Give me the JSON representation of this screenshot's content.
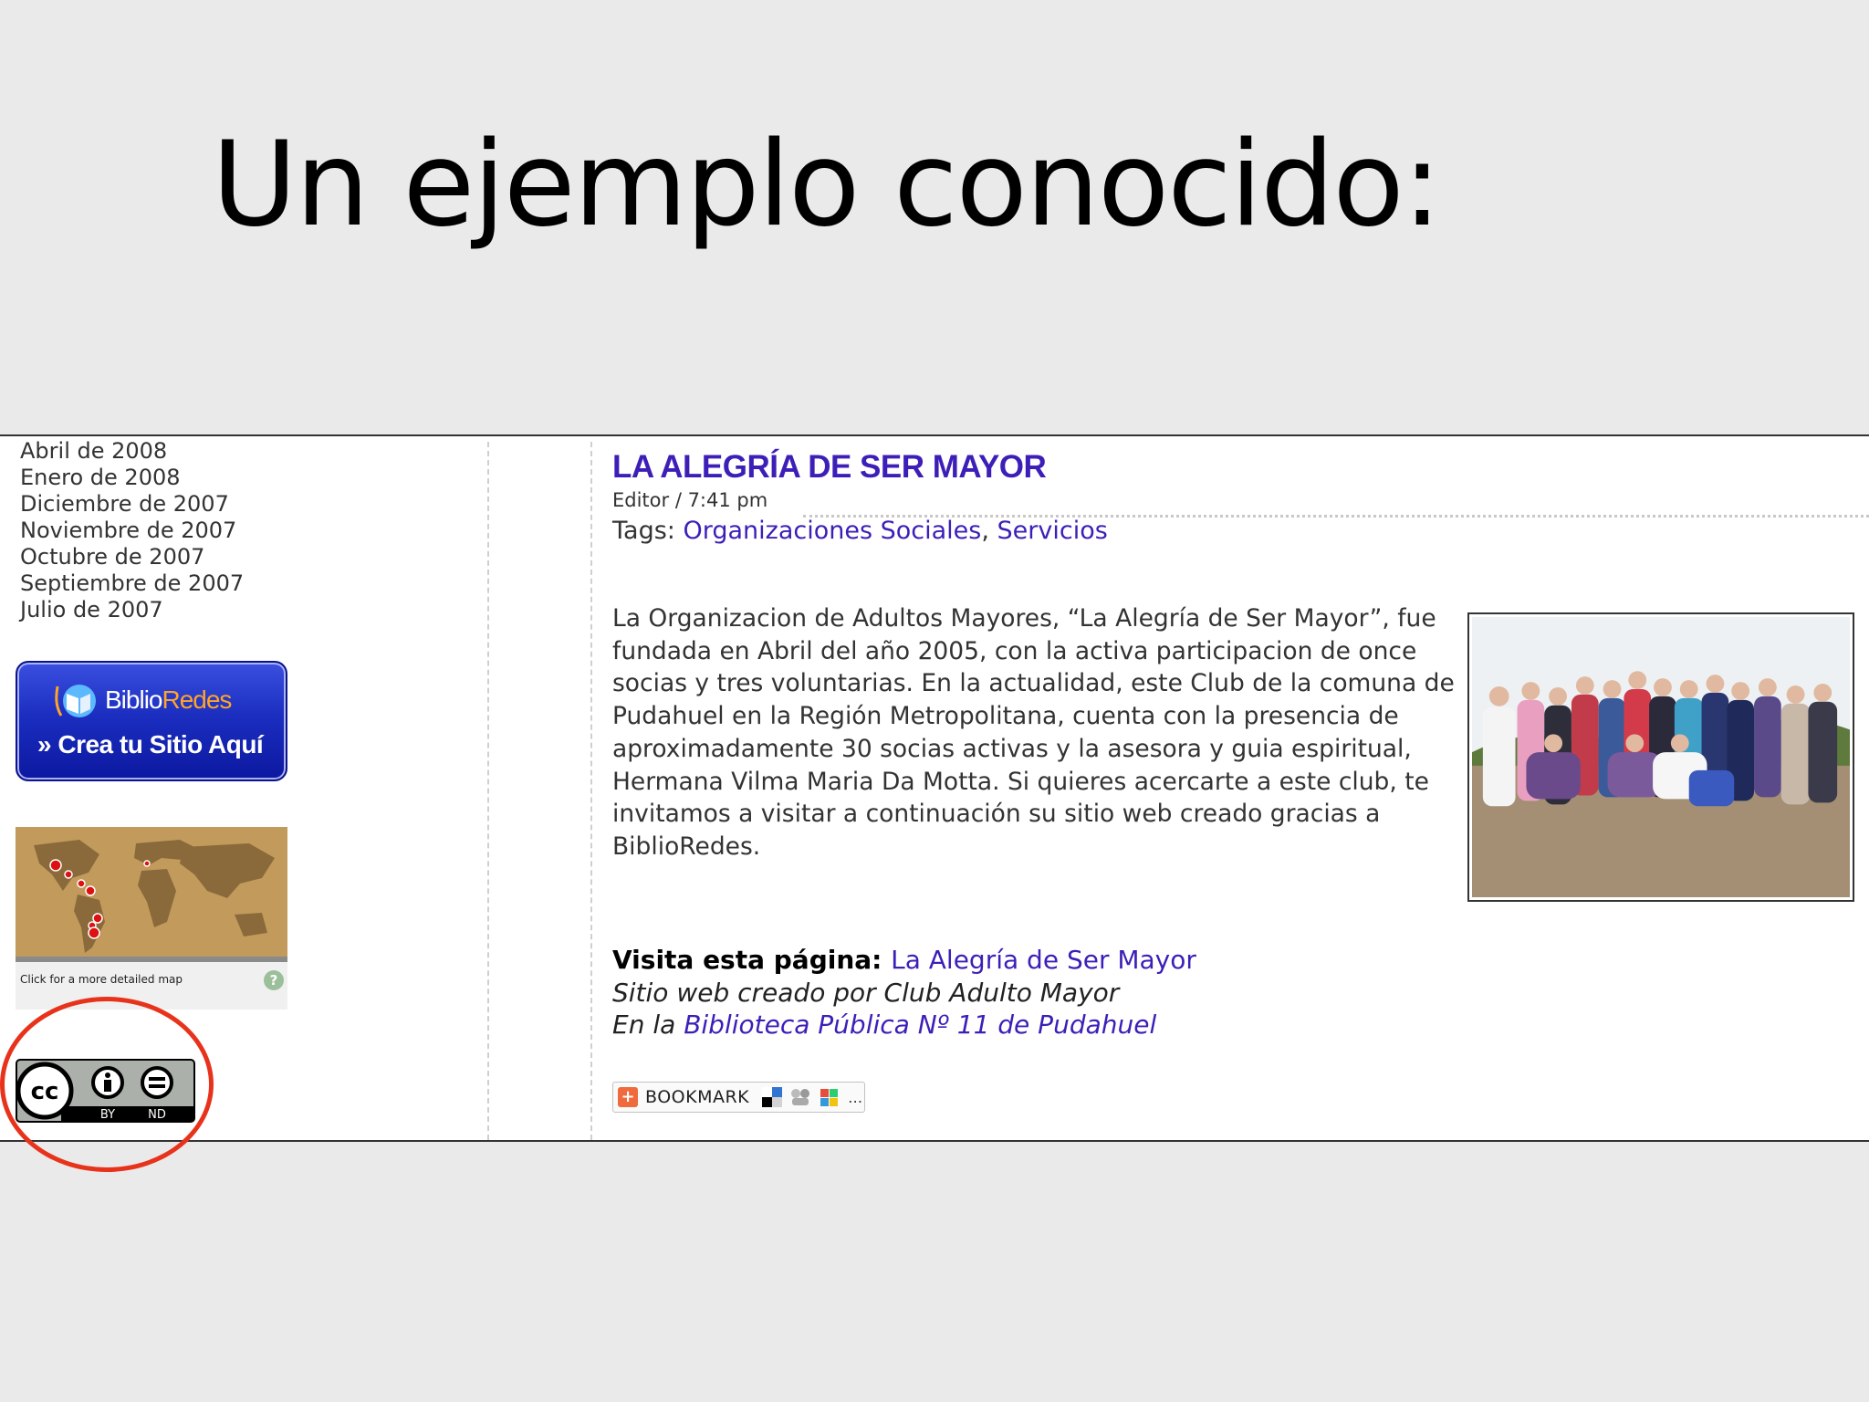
{
  "slide": {
    "title": "Un ejemplo conocido:"
  },
  "sidebar": {
    "archive": [
      "Abril de 2008",
      "Enero de 2008",
      "Diciembre de 2007",
      "Noviembre de 2007",
      "Octubre de 2007",
      "Septiembre de 2007",
      "Julio de 2007"
    ],
    "banner": {
      "brand_part1": "Biblio",
      "brand_part2": "Redes",
      "cta": "» Crea tu Sitio Aquí"
    },
    "map": {
      "caption": "Click for a more detailed map",
      "help": "?"
    },
    "license": {
      "cc": "cc",
      "by": "BY",
      "nd": "ND"
    }
  },
  "post": {
    "title": "LA ALEGRÍA DE SER MAYOR",
    "meta": "Editor / 7:41 pm",
    "tags_label": "Tags: ",
    "tags": [
      "Organizaciones Sociales",
      "Servicios"
    ],
    "tags_sep": ", ",
    "body": "La Organizacion de Adultos Mayores, “La Alegría de Ser Mayor”, fue fundada en Abril del año 2005, con la activa participacion de once socias y tres voluntarias. En la actualidad, este Club de la comuna de Pudahuel en la Región Metropolitana, cuenta con la presencia de aproximadamente 30 socias activas y la asesora y guia espiritual, Hermana Vilma Maria Da Motta. Si quieres acercarte a este club, te invitamos a visitar a continuación su sitio web creado gracias a BiblioRedes.",
    "visit_label": "Visita esta página: ",
    "visit_link": "La Alegría de Ser Mayor",
    "created_by": "Sitio web creado por Club Adulto Mayor",
    "library_prefix": "En la ",
    "library_link": "Biblioteca Pública Nº 11 de Pudahuel",
    "bookmark_label": "BOOKMARK"
  },
  "colors": {
    "link": "#3d1fb8",
    "highlight_circle": "#e8331c",
    "banner": "#1b2ec0"
  }
}
